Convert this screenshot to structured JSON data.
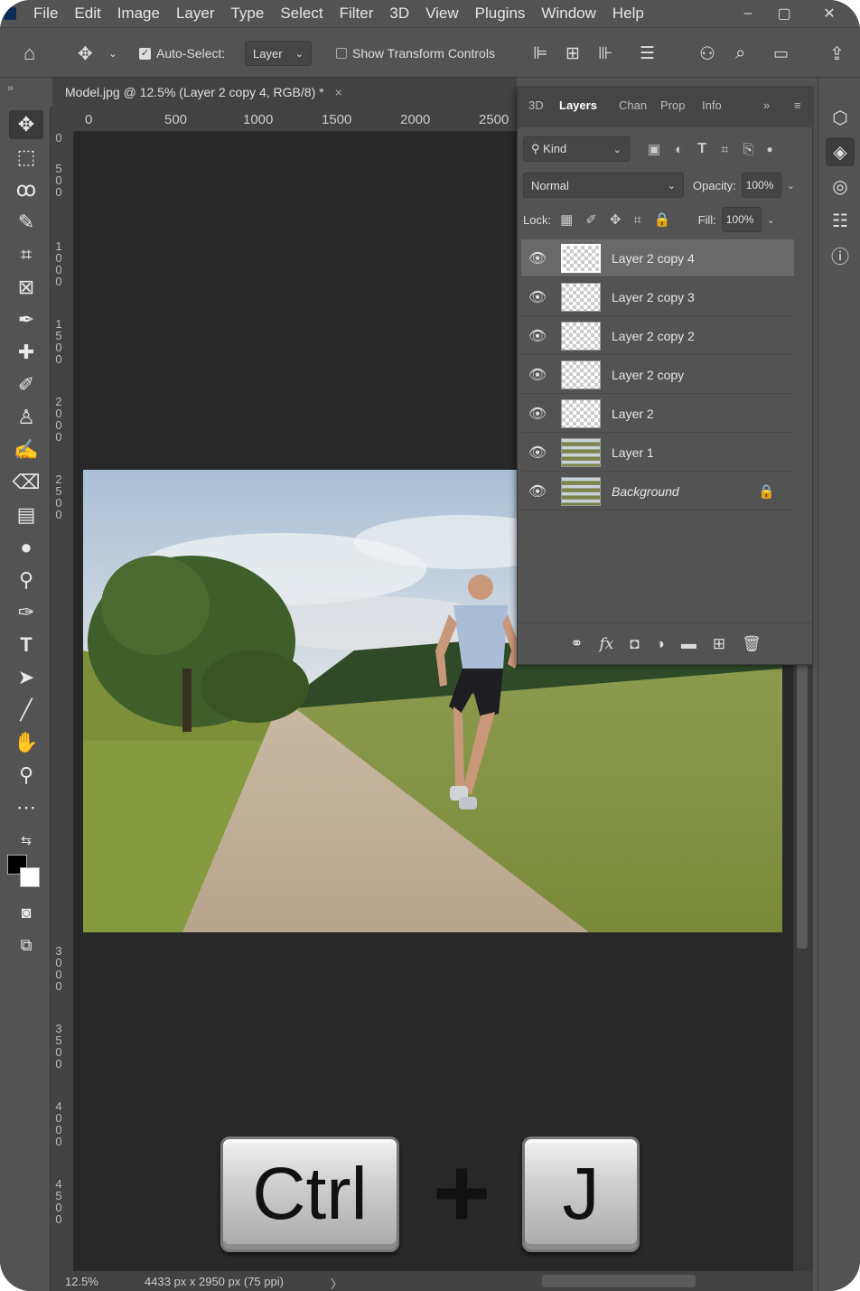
{
  "menu": [
    "File",
    "Edit",
    "Image",
    "Layer",
    "Type",
    "Select",
    "Filter",
    "3D",
    "View",
    "Plugins",
    "Window",
    "Help"
  ],
  "window_controls": {
    "minimize": "–",
    "maximize": "▢",
    "close": "✕"
  },
  "options_bar": {
    "auto_select_label": "Auto-Select:",
    "auto_select_checked": true,
    "auto_select_target": "Layer",
    "show_transform_label": "Show Transform Controls",
    "show_transform_checked": false
  },
  "document_tab": {
    "title": "Model.jpg @ 12.5% (Layer 2 copy 4, RGB/8) *",
    "close": "×"
  },
  "ruler_top": [
    "0",
    "500",
    "1000",
    "1500",
    "2000",
    "2500"
  ],
  "ruler_left": [
    "0",
    "500",
    "1000",
    "1500",
    "2000",
    "2500",
    "3000",
    "3500",
    "4000",
    "4500"
  ],
  "status": {
    "zoom": "12.5%",
    "info": "4433 px x 2950 px (75 ppi)",
    "arrow": "〉"
  },
  "panel": {
    "tabs": [
      "3D",
      "Layers",
      "Chan",
      "Prop",
      "Info"
    ],
    "active_tab": "Layers",
    "filter_label": "Kind",
    "blend_mode": "Normal",
    "opacity_label": "Opacity:",
    "opacity_value": "100%",
    "lock_label": "Lock:",
    "fill_label": "Fill:",
    "fill_value": "100%",
    "layers": [
      {
        "name": "Layer 2 copy 4",
        "selected": true,
        "thumb": "transparent"
      },
      {
        "name": "Layer 2 copy 3",
        "selected": false,
        "thumb": "transparent"
      },
      {
        "name": "Layer 2 copy 2",
        "selected": false,
        "thumb": "transparent"
      },
      {
        "name": "Layer 2 copy",
        "selected": false,
        "thumb": "transparent"
      },
      {
        "name": "Layer 2",
        "selected": false,
        "thumb": "transparent"
      },
      {
        "name": "Layer 1",
        "selected": false,
        "thumb": "photo"
      },
      {
        "name": "Background",
        "selected": false,
        "thumb": "photo",
        "locked": true
      }
    ]
  },
  "shortcut": {
    "key1": "Ctrl",
    "plus": "+",
    "key2": "J"
  },
  "colors": {
    "ui_bg": "#535353",
    "canvas_bg": "#282828",
    "panel_tab_bg": "#454545"
  }
}
